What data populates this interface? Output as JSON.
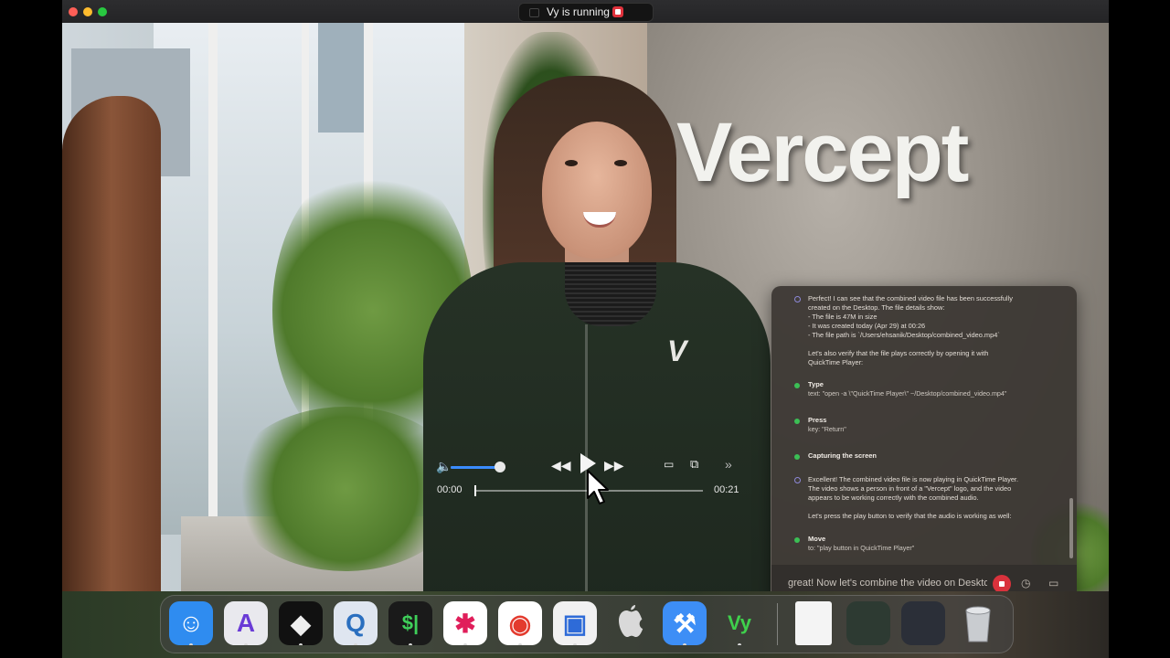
{
  "status_pill": {
    "text": "Vy is running"
  },
  "video": {
    "wall_logo": "Vercept",
    "chest_logo": "V",
    "time_elapsed": "00:00",
    "time_total": "00:21",
    "volume_level": 0.9,
    "playback_position": 0.0
  },
  "chat": {
    "message1": [
      "Perfect! I can see that the combined video file has been successfully",
      "created on the Desktop. The file details show:",
      "- The file is 47M in size",
      "- It was created today (Apr 29) at 00:26",
      "- The file path is `/Users/ehsanik/Desktop/combined_video.mp4`",
      "",
      "Let's also verify that the file plays correctly by opening it with",
      "QuickTime Player:"
    ],
    "steps1": [
      {
        "title": "Type",
        "detail": "text: \"open -a \\\"QuickTime Player\\\" ~/Desktop/combined_video.mp4\""
      },
      {
        "title": "Press",
        "detail": "key: \"Return\""
      },
      {
        "title": "Capturing the screen",
        "detail": ""
      }
    ],
    "message2": [
      "Excellent! The combined video file is now playing in QuickTime Player.",
      "The video shows a person in front of a \"Vercept\" logo, and the video",
      "appears to be working correctly with the combined audio.",
      "",
      "Let's press the play button to verify that the audio is working as well:"
    ],
    "steps2": [
      {
        "title": "Move",
        "detail": "to: \"play button in QuickTime Player\""
      }
    ],
    "input_text": "great! Now let's combine the video on Desktop"
  },
  "dock": {
    "apps": [
      {
        "name": "finder-icon",
        "glyph": "☺",
        "bg": "#2f8cf0",
        "fg": "#fff",
        "running": true
      },
      {
        "name": "affinity-icon",
        "glyph": "A",
        "bg": "#e9e9ee",
        "fg": "#6a3bd6",
        "running": true
      },
      {
        "name": "cube-app-icon",
        "glyph": "◆",
        "bg": "#111",
        "fg": "#eee",
        "running": true
      },
      {
        "name": "quicktime-icon",
        "glyph": "Q",
        "bg": "#dfe6f0",
        "fg": "#2a6fbf",
        "running": true
      },
      {
        "name": "terminal-icon",
        "glyph": "$|",
        "bg": "#1a1a1a",
        "fg": "#3fd05a",
        "running": true
      },
      {
        "name": "slack-icon",
        "glyph": "✱",
        "bg": "#ffffff",
        "fg": "#e01e5a",
        "running": true
      },
      {
        "name": "chrome-icon",
        "glyph": "◉",
        "bg": "#ffffff",
        "fg": "#e33b2e",
        "running": true
      },
      {
        "name": "screen-sharing-icon",
        "glyph": "▣",
        "bg": "#f1f1f1",
        "fg": "#2e6bd8",
        "running": true
      },
      {
        "name": "apple-icon",
        "glyph": "",
        "bg": "transparent",
        "fg": "#d9d9d9",
        "running": false
      },
      {
        "name": "xcode-icon",
        "glyph": "⚒",
        "bg": "#3d8ef6",
        "fg": "#ffffff",
        "running": true
      },
      {
        "name": "vy-icon",
        "glyph": "Vy",
        "bg": "transparent",
        "fg": "#3fd04c",
        "running": true
      }
    ],
    "docs": [
      {
        "name": "document-icon",
        "bg": "#f4f4f4"
      },
      {
        "name": "window-thumbnail-icon",
        "bg": "#2d3a32"
      },
      {
        "name": "window-thumbnail-icon-2",
        "bg": "#2b2f38"
      },
      {
        "name": "trash-icon",
        "bg": "transparent"
      }
    ]
  }
}
